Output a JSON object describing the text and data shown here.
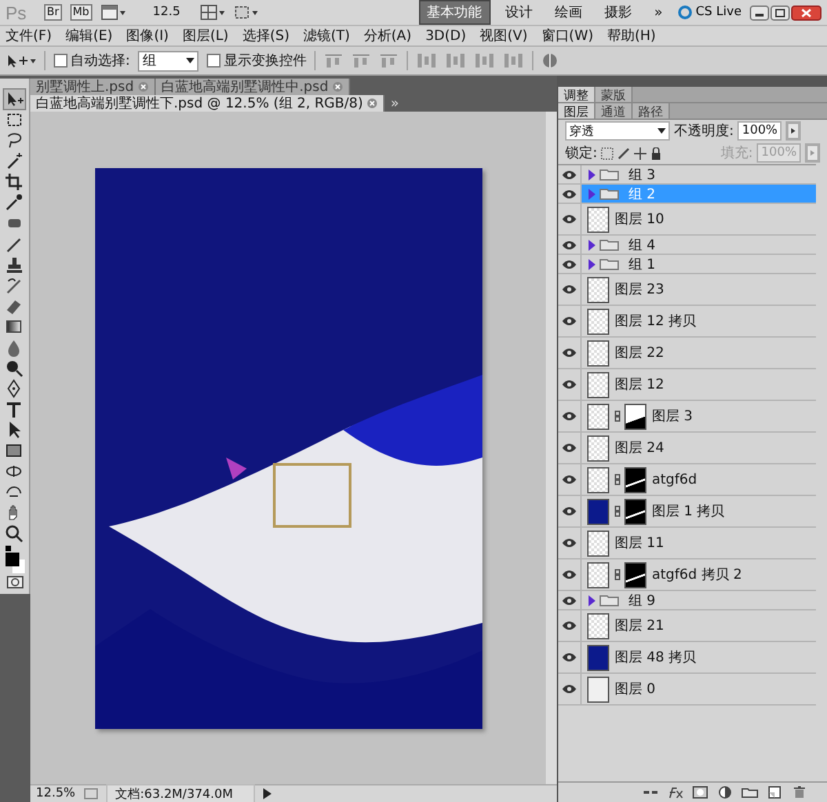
{
  "app_bar": {
    "logo": "Ps",
    "bridge": "Br",
    "mini_bridge": "Mb",
    "zoom": "12.5",
    "workspaces": [
      {
        "label": "基本功能",
        "selected": true
      },
      {
        "label": "设计",
        "selected": false
      },
      {
        "label": "绘画",
        "selected": false
      },
      {
        "label": "摄影",
        "selected": false
      }
    ],
    "more": "»",
    "cs_live": "CS Live"
  },
  "menu": [
    "文件(F)",
    "编辑(E)",
    "图像(I)",
    "图层(L)",
    "选择(S)",
    "滤镜(T)",
    "分析(A)",
    "3D(D)",
    "视图(V)",
    "窗口(W)",
    "帮助(H)"
  ],
  "options_bar": {
    "auto_select": {
      "label": "自动选择:",
      "checked": false
    },
    "auto_select_target": "组",
    "transform_controls": {
      "label": "显示变换控件",
      "checked": false
    }
  },
  "document_tabs": [
    {
      "label": "别墅调性上.psd",
      "selected": false
    },
    {
      "label": "白蓝地高端别墅调性中.psd",
      "selected": false
    },
    {
      "label": "白蓝地高端别墅调性下.psd @ 12.5% (组 2, RGB/8)",
      "selected": true
    }
  ],
  "tabs_more": "»",
  "status_bar": {
    "zoom": "12.5%",
    "document": "文档:63.2M/374.0M"
  },
  "panels": {
    "top_tabs": [
      {
        "label": "调整",
        "selected": true
      },
      {
        "label": "蒙版",
        "selected": false
      }
    ],
    "layer_tabs": [
      {
        "label": "图层",
        "selected": true
      },
      {
        "label": "通道",
        "selected": false
      },
      {
        "label": "路径",
        "selected": false
      }
    ],
    "blend_mode": "穿透",
    "opacity_label": "不透明度:",
    "opacity": "100%",
    "lock_label": "锁定:",
    "fill_label": "填充:",
    "fill": "100%",
    "fill_disabled": true
  },
  "layers": [
    {
      "kind": "group",
      "name": "组 3",
      "selected": false,
      "visible": true,
      "expanded": false
    },
    {
      "kind": "group",
      "name": "组 2",
      "selected": true,
      "visible": true,
      "expanded": false
    },
    {
      "kind": "layer",
      "name": "图层 10",
      "selected": false,
      "visible": true
    },
    {
      "kind": "group",
      "name": "组 4",
      "selected": false,
      "visible": true,
      "expanded": false
    },
    {
      "kind": "group",
      "name": "组 1",
      "selected": false,
      "visible": true,
      "expanded": false
    },
    {
      "kind": "layer",
      "name": "图层 23",
      "selected": false,
      "visible": true
    },
    {
      "kind": "layer",
      "name": "图层 12 拷贝",
      "selected": false,
      "visible": true
    },
    {
      "kind": "layer",
      "name": "图层 22",
      "selected": false,
      "visible": true
    },
    {
      "kind": "layer",
      "name": "图层 12",
      "selected": false,
      "visible": true
    },
    {
      "kind": "layer",
      "name": "图层 3",
      "selected": false,
      "visible": true,
      "mask": true,
      "mask_inverted": false
    },
    {
      "kind": "layer",
      "name": "图层 24",
      "selected": false,
      "visible": true
    },
    {
      "kind": "layer",
      "name": "atgf6d",
      "selected": false,
      "visible": true,
      "mask": true,
      "mask_inverted": true
    },
    {
      "kind": "layer",
      "name": "图层 1 拷贝",
      "selected": false,
      "visible": true,
      "color": "#0c1a8c",
      "mask": true,
      "mask_inverted": true
    },
    {
      "kind": "layer",
      "name": "图层 11",
      "selected": false,
      "visible": true
    },
    {
      "kind": "layer",
      "name": "atgf6d 拷贝 2",
      "selected": false,
      "visible": true,
      "mask": true,
      "mask_inverted": true
    },
    {
      "kind": "group",
      "name": "组 9",
      "selected": false,
      "visible": true,
      "expanded": false
    },
    {
      "kind": "layer",
      "name": "图层 21",
      "selected": false,
      "visible": true
    },
    {
      "kind": "layer",
      "name": "图层 48 拷贝",
      "selected": false,
      "visible": true,
      "color": "#0c1a8c"
    },
    {
      "kind": "layer",
      "name": "图层 0",
      "selected": false,
      "visible": true,
      "color": "#f0f0f0"
    }
  ]
}
